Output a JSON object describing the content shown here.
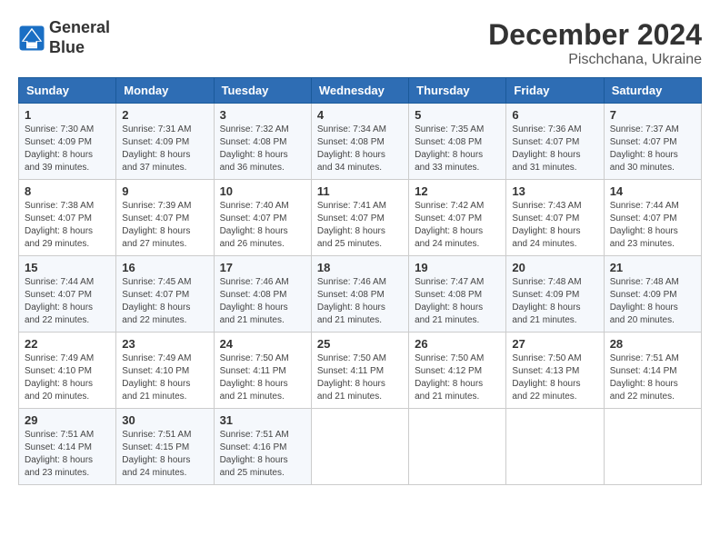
{
  "logo": {
    "line1": "General",
    "line2": "Blue"
  },
  "title": "December 2024",
  "subtitle": "Pischchana, Ukraine",
  "weekdays": [
    "Sunday",
    "Monday",
    "Tuesday",
    "Wednesday",
    "Thursday",
    "Friday",
    "Saturday"
  ],
  "weeks": [
    [
      {
        "day": 1,
        "sunrise": "7:30 AM",
        "sunset": "4:09 PM",
        "daylight": "8 hours and 39 minutes."
      },
      {
        "day": 2,
        "sunrise": "7:31 AM",
        "sunset": "4:09 PM",
        "daylight": "8 hours and 37 minutes."
      },
      {
        "day": 3,
        "sunrise": "7:32 AM",
        "sunset": "4:08 PM",
        "daylight": "8 hours and 36 minutes."
      },
      {
        "day": 4,
        "sunrise": "7:34 AM",
        "sunset": "4:08 PM",
        "daylight": "8 hours and 34 minutes."
      },
      {
        "day": 5,
        "sunrise": "7:35 AM",
        "sunset": "4:08 PM",
        "daylight": "8 hours and 33 minutes."
      },
      {
        "day": 6,
        "sunrise": "7:36 AM",
        "sunset": "4:07 PM",
        "daylight": "8 hours and 31 minutes."
      },
      {
        "day": 7,
        "sunrise": "7:37 AM",
        "sunset": "4:07 PM",
        "daylight": "8 hours and 30 minutes."
      }
    ],
    [
      {
        "day": 8,
        "sunrise": "7:38 AM",
        "sunset": "4:07 PM",
        "daylight": "8 hours and 29 minutes."
      },
      {
        "day": 9,
        "sunrise": "7:39 AM",
        "sunset": "4:07 PM",
        "daylight": "8 hours and 27 minutes."
      },
      {
        "day": 10,
        "sunrise": "7:40 AM",
        "sunset": "4:07 PM",
        "daylight": "8 hours and 26 minutes."
      },
      {
        "day": 11,
        "sunrise": "7:41 AM",
        "sunset": "4:07 PM",
        "daylight": "8 hours and 25 minutes."
      },
      {
        "day": 12,
        "sunrise": "7:42 AM",
        "sunset": "4:07 PM",
        "daylight": "8 hours and 24 minutes."
      },
      {
        "day": 13,
        "sunrise": "7:43 AM",
        "sunset": "4:07 PM",
        "daylight": "8 hours and 24 minutes."
      },
      {
        "day": 14,
        "sunrise": "7:44 AM",
        "sunset": "4:07 PM",
        "daylight": "8 hours and 23 minutes."
      }
    ],
    [
      {
        "day": 15,
        "sunrise": "7:44 AM",
        "sunset": "4:07 PM",
        "daylight": "8 hours and 22 minutes."
      },
      {
        "day": 16,
        "sunrise": "7:45 AM",
        "sunset": "4:07 PM",
        "daylight": "8 hours and 22 minutes."
      },
      {
        "day": 17,
        "sunrise": "7:46 AM",
        "sunset": "4:08 PM",
        "daylight": "8 hours and 21 minutes."
      },
      {
        "day": 18,
        "sunrise": "7:46 AM",
        "sunset": "4:08 PM",
        "daylight": "8 hours and 21 minutes."
      },
      {
        "day": 19,
        "sunrise": "7:47 AM",
        "sunset": "4:08 PM",
        "daylight": "8 hours and 21 minutes."
      },
      {
        "day": 20,
        "sunrise": "7:48 AM",
        "sunset": "4:09 PM",
        "daylight": "8 hours and 21 minutes."
      },
      {
        "day": 21,
        "sunrise": "7:48 AM",
        "sunset": "4:09 PM",
        "daylight": "8 hours and 20 minutes."
      }
    ],
    [
      {
        "day": 22,
        "sunrise": "7:49 AM",
        "sunset": "4:10 PM",
        "daylight": "8 hours and 20 minutes."
      },
      {
        "day": 23,
        "sunrise": "7:49 AM",
        "sunset": "4:10 PM",
        "daylight": "8 hours and 21 minutes."
      },
      {
        "day": 24,
        "sunrise": "7:50 AM",
        "sunset": "4:11 PM",
        "daylight": "8 hours and 21 minutes."
      },
      {
        "day": 25,
        "sunrise": "7:50 AM",
        "sunset": "4:11 PM",
        "daylight": "8 hours and 21 minutes."
      },
      {
        "day": 26,
        "sunrise": "7:50 AM",
        "sunset": "4:12 PM",
        "daylight": "8 hours and 21 minutes."
      },
      {
        "day": 27,
        "sunrise": "7:50 AM",
        "sunset": "4:13 PM",
        "daylight": "8 hours and 22 minutes."
      },
      {
        "day": 28,
        "sunrise": "7:51 AM",
        "sunset": "4:14 PM",
        "daylight": "8 hours and 22 minutes."
      }
    ],
    [
      {
        "day": 29,
        "sunrise": "7:51 AM",
        "sunset": "4:14 PM",
        "daylight": "8 hours and 23 minutes."
      },
      {
        "day": 30,
        "sunrise": "7:51 AM",
        "sunset": "4:15 PM",
        "daylight": "8 hours and 24 minutes."
      },
      {
        "day": 31,
        "sunrise": "7:51 AM",
        "sunset": "4:16 PM",
        "daylight": "8 hours and 25 minutes."
      },
      null,
      null,
      null,
      null
    ]
  ]
}
